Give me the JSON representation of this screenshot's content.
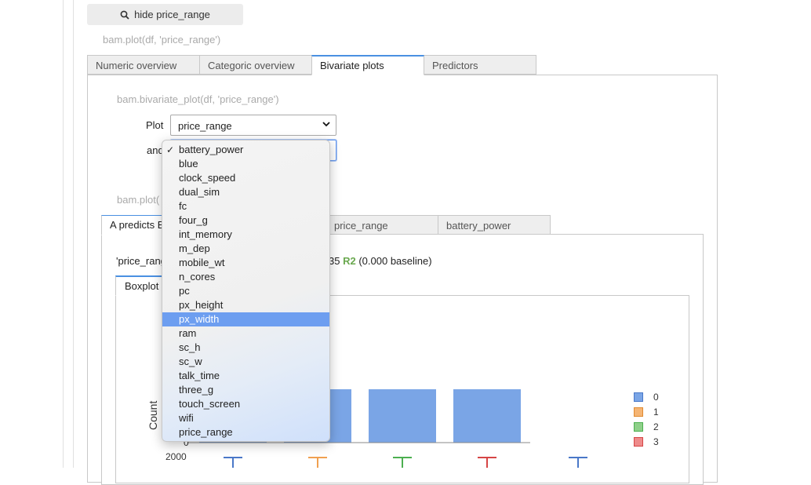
{
  "colors": {
    "accent": "#4a90e2",
    "highlight": "#6d9ef0",
    "bar": "#7aa5e6",
    "r2_label": "#6aa84f"
  },
  "hide_button": {
    "label": "hide price_range",
    "icon": "search-icon"
  },
  "code_line_top": "bam.plot(df, 'price_range')",
  "outer_tabs": [
    "Numeric overview",
    "Categoric overview",
    "Bivariate plots",
    "Predictors"
  ],
  "bivariate": {
    "code_line": "bam.bivariate_plot(df, 'price_range')",
    "plot_label": "Plot",
    "plot_value": "price_range",
    "and_label": "and",
    "code_line_partial": "bam.plot("
  },
  "inner_tabs": [
    "A predicts B",
    "price_range",
    "battery_power"
  ],
  "score": {
    "left": "'price_rang",
    "right": "35",
    "r2_label": "R2",
    "baseline": "(0.000 baseline)"
  },
  "plot_tabs": [
    "Boxplot"
  ],
  "dropdown": {
    "selected": "battery_power",
    "highlighted": "px_width",
    "check": "✓",
    "options": [
      "battery_power",
      "blue",
      "clock_speed",
      "dual_sim",
      "fc",
      "four_g",
      "int_memory",
      "m_dep",
      "mobile_wt",
      "n_cores",
      "pc",
      "px_height",
      "px_width",
      "ram",
      "sc_h",
      "sc_w",
      "talk_time",
      "three_g",
      "touch_screen",
      "wifi",
      "price_range"
    ]
  },
  "chart_data": {
    "type": "bar",
    "ylabel": "Count",
    "y_ticks": [
      "0"
    ],
    "bars_visible": 4,
    "legend": [
      {
        "name": "0",
        "color": "#7aa5e6"
      },
      {
        "name": "1",
        "color": "#f5b574"
      },
      {
        "name": "2",
        "color": "#8fd08a"
      },
      {
        "name": "3",
        "color": "#ee8b8b"
      }
    ],
    "second_plot_tick": "2000"
  }
}
